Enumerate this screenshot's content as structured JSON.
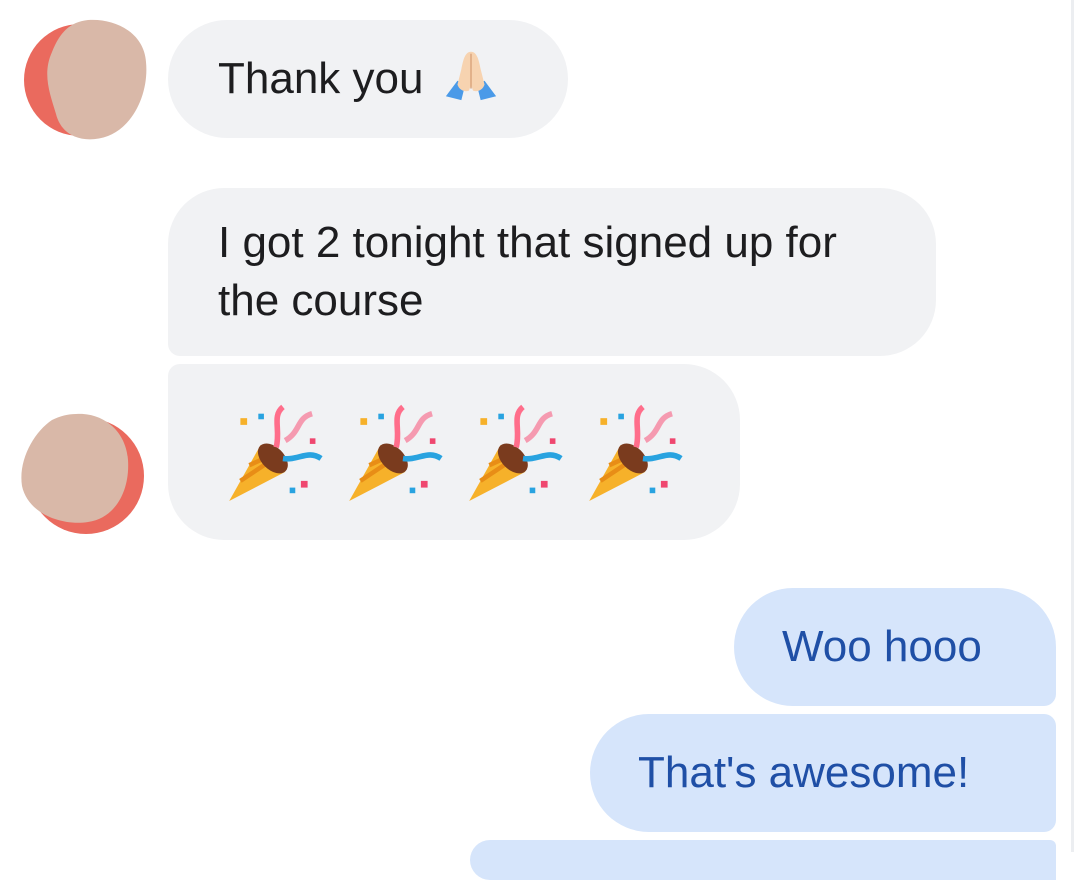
{
  "conversation": {
    "messages": [
      {
        "from": "contact",
        "text": "Thank you",
        "emoji": "folded-hands"
      },
      {
        "from": "contact",
        "text": "I got 2 tonight that signed up for the course"
      },
      {
        "from": "contact",
        "emoji": "party-popper",
        "emoji_count": 4
      },
      {
        "from": "me",
        "text": "Woo hooo"
      },
      {
        "from": "me",
        "text": "That's awesome!"
      }
    ]
  },
  "colors": {
    "incoming_bubble": "#f1f2f4",
    "outgoing_bubble": "#d6e5fb",
    "outgoing_text": "#1f4fa6",
    "avatar_ring": "#ea6a5e",
    "avatar_blur": "#d9b8a8"
  }
}
